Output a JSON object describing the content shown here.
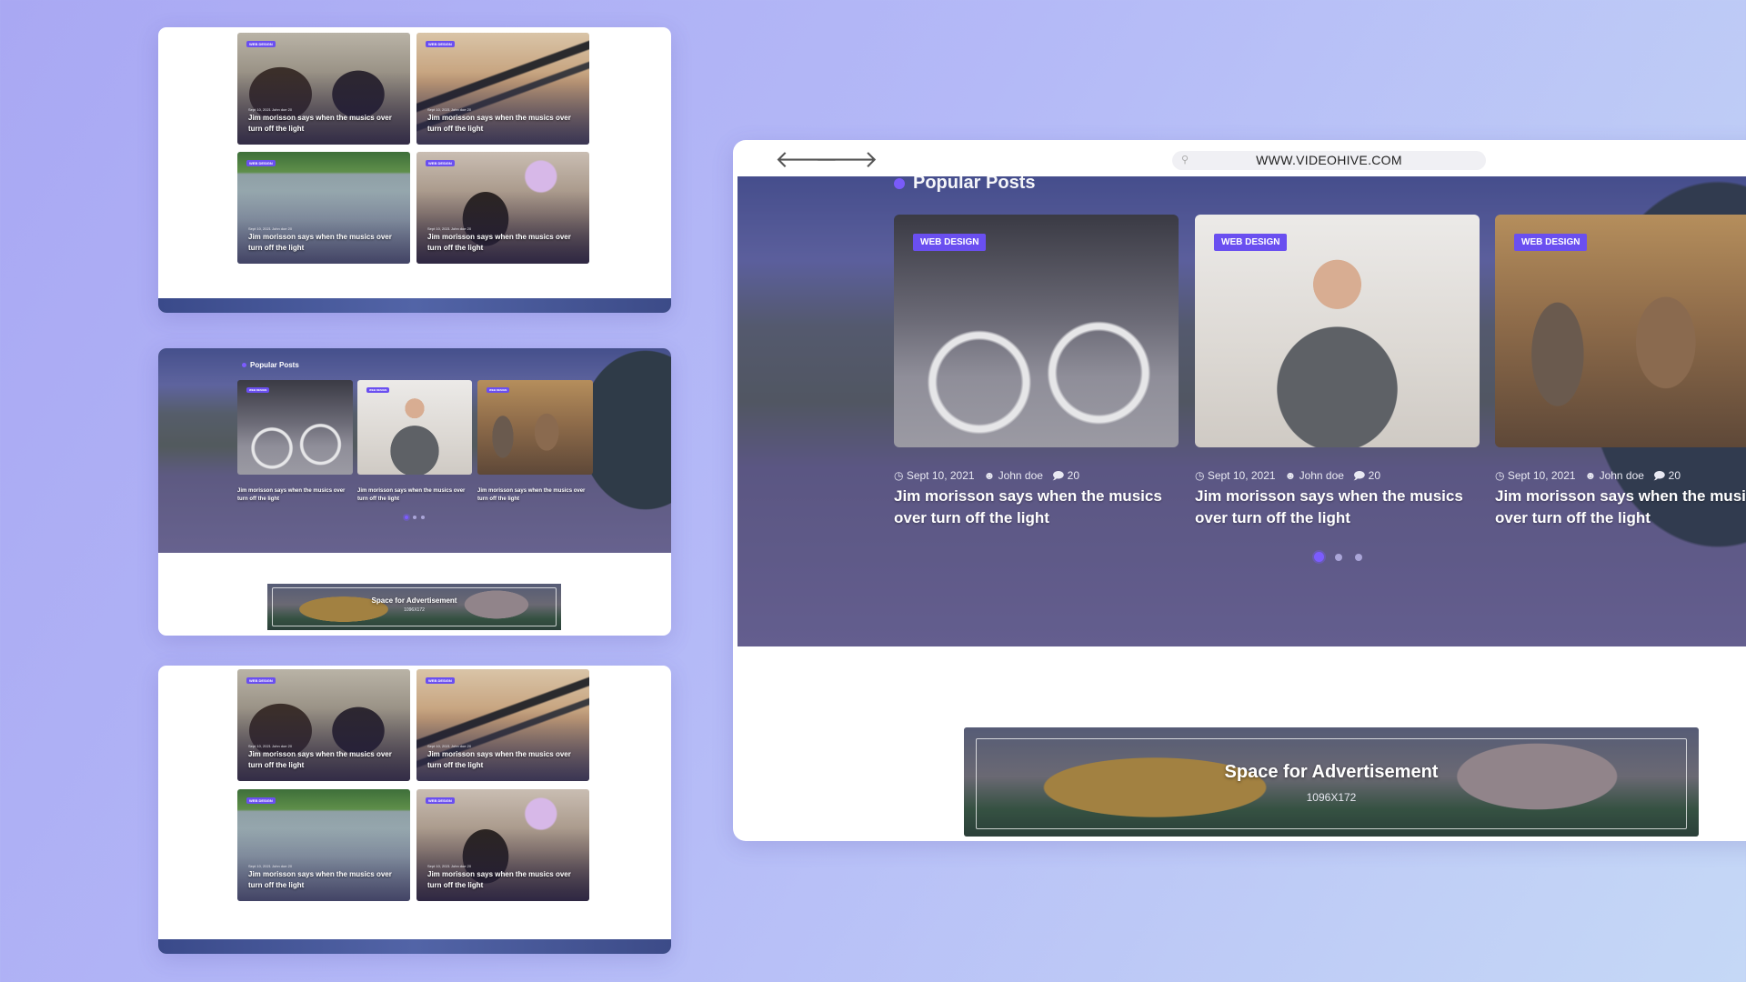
{
  "browser": {
    "url": "WWW.VIDEOHIVE.COM",
    "back_arrow": "🡐",
    "forward_arrow": "🡒"
  },
  "popular_posts": {
    "heading": "Popular Posts",
    "posts": [
      {
        "badge": "WEB DESIGN",
        "date": "Sept 10, 2021",
        "author": "John doe",
        "comments": "20",
        "title": "Jim morisson says when the musics over turn off the light"
      },
      {
        "badge": "WEB DESIGN",
        "date": "Sept 10, 2021",
        "author": "John doe",
        "comments": "20",
        "title": "Jim morisson says when the musics over turn off the light"
      },
      {
        "badge": "WEB DESIGN",
        "date": "Sept 10, 2021",
        "author": "John doe",
        "comments": "20",
        "title": "Jim morisson says when the musics over turn off the light"
      }
    ],
    "active_slide": 1,
    "slide_count": 3
  },
  "advertisement": {
    "title": "Space for Advertisement",
    "size": "1096X172"
  },
  "grid_posts": [
    {
      "badge": "WEB DESIGN",
      "meta": "Sept 10, 2021  John doe  20",
      "title": "Jim morisson says when the musics over turn off the light"
    },
    {
      "badge": "WEB DESIGN",
      "meta": "Sept 10, 2021  John doe  20",
      "title": "Jim morisson says when the musics over turn off the light"
    },
    {
      "badge": "WEB DESIGN",
      "meta": "Sept 10, 2021  John doe  20",
      "title": "Jim morisson says when the musics over turn off the light"
    },
    {
      "badge": "WEB DESIGN",
      "meta": "Sept 10, 2021  John doe  20",
      "title": "Jim morisson says when the musics over turn off the light"
    }
  ],
  "icons": {
    "date": "clock-icon",
    "author": "user-icon",
    "comments": "comment-icon",
    "search": "search-icon"
  },
  "colors": {
    "accent": "#6a4ff0",
    "background_start": "#a9a8f3",
    "background_end": "#c5d8f6"
  }
}
